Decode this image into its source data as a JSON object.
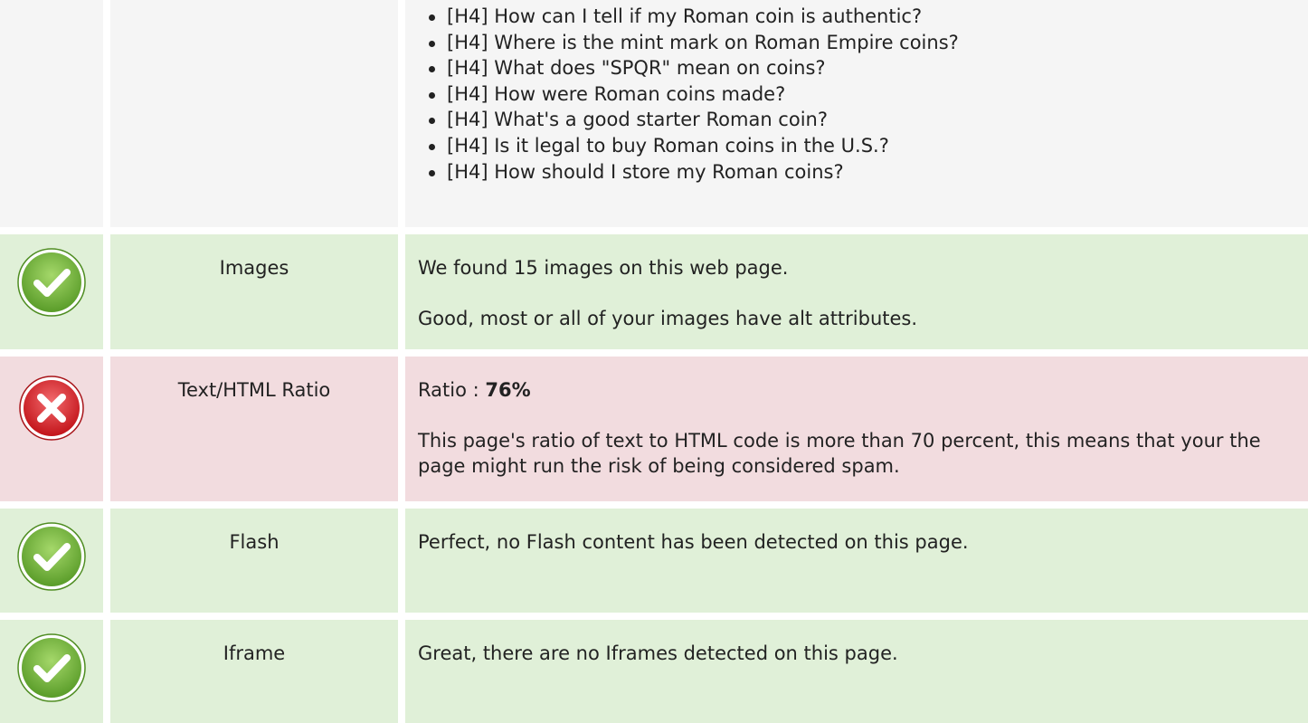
{
  "headings_row": {
    "items": [
      "[H4] How can I tell if my Roman coin is authentic?",
      "[H4] Where is the mint mark on Roman Empire coins?",
      "[H4] What does \"SPQR\" mean on coins?",
      "[H4] How were Roman coins made?",
      "[H4] What's a good starter Roman coin?",
      "[H4] Is it legal to buy Roman coins in the U.S.?",
      "[H4] How should I store my Roman coins?"
    ]
  },
  "images": {
    "label": "Images",
    "line1": "We found 15 images on this web page.",
    "line2": "Good, most or all of your images have alt attributes."
  },
  "ratio": {
    "label": "Text/HTML Ratio",
    "prefix": "Ratio : ",
    "value": "76%",
    "line2": "This page's ratio of text to HTML code is more than 70 percent, this means that your the page might run the risk of being considered spam."
  },
  "flash": {
    "label": "Flash",
    "line1": "Perfect, no Flash content has been detected on this page."
  },
  "iframe": {
    "label": "Iframe",
    "line1": "Great, there are no Iframes detected on this page."
  },
  "colors": {
    "pass_bg": "#e0f0d8",
    "fail_bg": "#f2dcdf",
    "neutral_bg": "#f5f5f5",
    "pass_icon": "#7ac143",
    "fail_icon": "#e0393e"
  },
  "icons": {
    "pass": "check-circle-icon",
    "fail": "x-circle-icon"
  }
}
